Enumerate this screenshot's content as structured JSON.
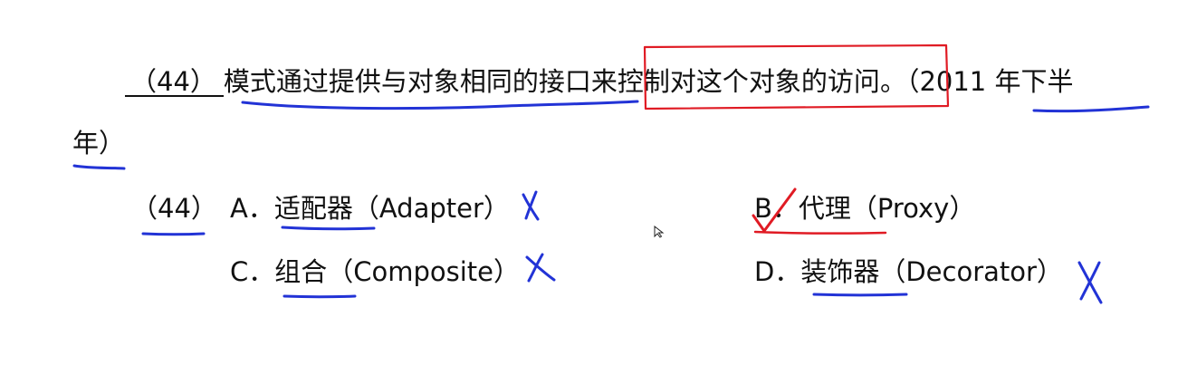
{
  "question": {
    "number_blank": "（44）",
    "stem_part1": "模式通过提供与对象相同的接口来",
    "stem_highlight": "控制对这个对象的访问",
    "stem_end": "。（2011 年下半",
    "stem_wrap": "年）"
  },
  "answers": {
    "number": "（44）",
    "options": [
      {
        "letter": "A．",
        "text": "适配器（Adapter）"
      },
      {
        "letter": "B．",
        "text": "代理（Proxy）"
      },
      {
        "letter": "C．",
        "text": "组合（Composite）"
      },
      {
        "letter": "D．",
        "text": "装饰器（Decorator）"
      }
    ]
  },
  "annotations": {
    "underline_color": "#2233d6",
    "box_color": "#e01b24",
    "check_color": "#e01b24",
    "cross_color": "#2233d6"
  }
}
